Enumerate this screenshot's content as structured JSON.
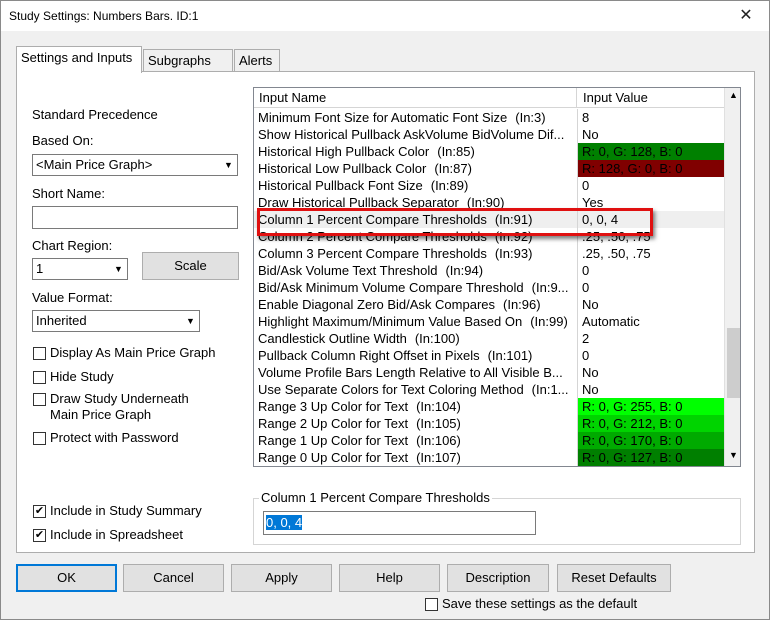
{
  "window": {
    "title": "Study Settings: Numbers Bars. ID:1",
    "close_glyph": "✕"
  },
  "tabs": [
    "Settings and Inputs",
    "Subgraphs",
    "Alerts"
  ],
  "left": {
    "standard_precedence": "Standard Precedence",
    "based_on_label": "Based On:",
    "based_on_value": "<Main Price Graph>",
    "short_name_label": "Short Name:",
    "short_name_value": "",
    "chart_region_label": "Chart Region:",
    "chart_region_value": "1",
    "scale_button": "Scale",
    "value_format_label": "Value Format:",
    "value_format_value": "Inherited",
    "checkboxes": [
      {
        "label": "Display As Main Price Graph",
        "checked": false
      },
      {
        "label": "Hide Study",
        "checked": false
      },
      {
        "label": "Draw Study Underneath",
        "label2": "Main Price Graph",
        "checked": false
      },
      {
        "label": "Protect with Password",
        "checked": false
      },
      {
        "label": "Include in Study Summary",
        "checked": true
      },
      {
        "label": "Include in Spreadsheet",
        "checked": true
      }
    ]
  },
  "grid": {
    "col_name": "Input Name",
    "col_value": "Input Value",
    "rows": [
      {
        "name": "Minimum Font Size for Automatic Font Size",
        "ln": "(In:3)",
        "value": "8",
        "bg": ""
      },
      {
        "name": "Show Historical Pullback AskVolume BidVolume Dif...",
        "ln": "",
        "value": "No",
        "bg": ""
      },
      {
        "name": "Historical High Pullback Color",
        "ln": "(In:85)",
        "value": "R: 0, G: 128, B: 0",
        "bg": "#008000"
      },
      {
        "name": "Historical Low Pullback Color",
        "ln": "(In:87)",
        "value": "R: 128, G: 0, B: 0",
        "bg": "#800000"
      },
      {
        "name": "Historical Pullback Font Size",
        "ln": "(In:89)",
        "value": "0",
        "bg": ""
      },
      {
        "name": "Draw Historical Pullback Separator",
        "ln": "(In:90)",
        "value": "Yes",
        "bg": ""
      },
      {
        "name": "Column 1 Percent Compare Thresholds",
        "ln": "(In:91)",
        "value": "0, 0, 4",
        "bg": "",
        "selected": true
      },
      {
        "name": "Column 2 Percent Compare Thresholds",
        "ln": "(In:92)",
        "value": ".25, .50, .75",
        "bg": ""
      },
      {
        "name": "Column 3 Percent Compare Thresholds",
        "ln": "(In:93)",
        "value": ".25, .50, .75",
        "bg": ""
      },
      {
        "name": "Bid/Ask Volume Text Threshold",
        "ln": "(In:94)",
        "value": "0",
        "bg": ""
      },
      {
        "name": "Bid/Ask Minimum Volume Compare Threshold",
        "ln": "(In:9...",
        "value": "0",
        "bg": ""
      },
      {
        "name": "Enable Diagonal Zero Bid/Ask Compares",
        "ln": "(In:96)",
        "value": "No",
        "bg": ""
      },
      {
        "name": "Highlight Maximum/Minimum Value Based On",
        "ln": "(In:99)",
        "value": "Automatic",
        "bg": ""
      },
      {
        "name": "Candlestick Outline Width",
        "ln": "(In:100)",
        "value": "2",
        "bg": ""
      },
      {
        "name": "Pullback Column Right Offset in Pixels",
        "ln": "(In:101)",
        "value": "0",
        "bg": ""
      },
      {
        "name": "Volume Profile Bars Length Relative to All Visible B...",
        "ln": "",
        "value": "No",
        "bg": ""
      },
      {
        "name": "Use Separate Colors for Text Coloring Method",
        "ln": "(In:1...",
        "value": "No",
        "bg": ""
      },
      {
        "name": "Range 3 Up Color for Text",
        "ln": "(In:104)",
        "value": "R: 0, G: 255, B: 0",
        "bg": "#00ff00"
      },
      {
        "name": "Range 2 Up Color for Text",
        "ln": "(In:105)",
        "value": "R: 0, G: 212, B: 0",
        "bg": "#00d400"
      },
      {
        "name": "Range 1 Up Color for Text",
        "ln": "(In:106)",
        "value": "R: 0, G: 170, B: 0",
        "bg": "#00aa00"
      },
      {
        "name": "Range 0 Up Color for Text",
        "ln": "(In:107)",
        "value": "R: 0, G: 127, B: 0",
        "bg": "#007f00"
      }
    ]
  },
  "edit_group": {
    "title": "Column 1 Percent Compare Thresholds",
    "value": "0, 0, 4"
  },
  "buttons": {
    "ok": "OK",
    "cancel": "Cancel",
    "apply": "Apply",
    "help": "Help",
    "description": "Description",
    "reset": "Reset Defaults"
  },
  "save_default": {
    "label": "Save these settings as the default",
    "checked": false
  },
  "colors": {
    "highlight_border": "#e01010",
    "selection_blue": "#0078d7"
  }
}
